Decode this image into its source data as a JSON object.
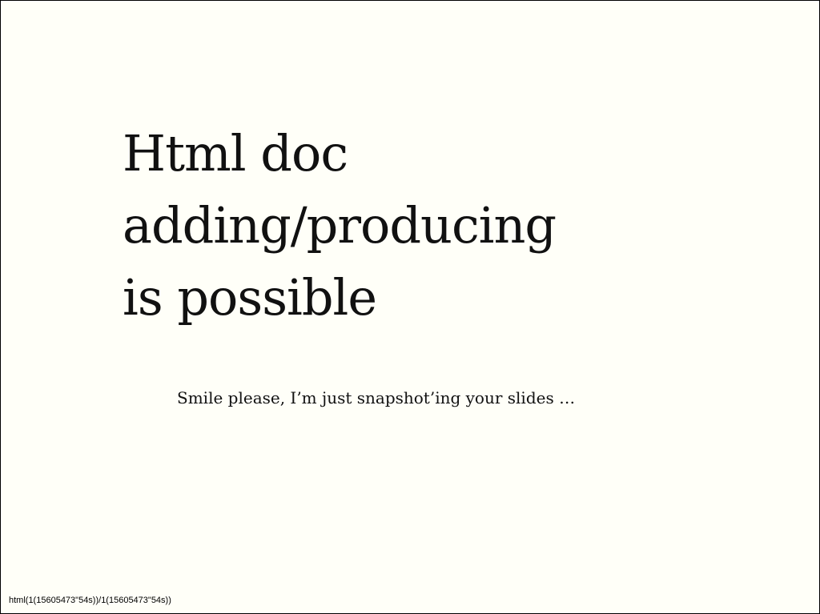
{
  "slide": {
    "title_lines": [
      "Html doc",
      "adding/producing",
      "is possible"
    ],
    "subtitle": "Smile please, I’m just snapshot’ing your slides …",
    "footer": "html(1(15605473\"54s))/1(15605473\"54s))"
  },
  "colors": {
    "background": "#fffff8",
    "text": "#111111",
    "border": "#000000"
  }
}
